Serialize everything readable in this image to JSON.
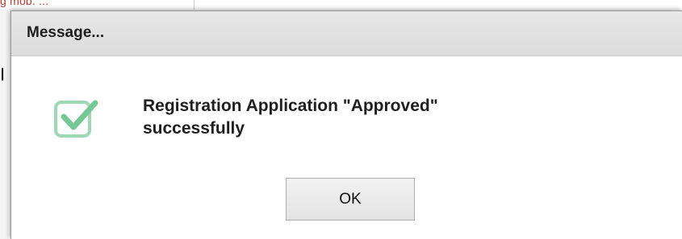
{
  "background": {
    "partial_text": "g mob. ...",
    "partial_char": "I"
  },
  "dialog": {
    "title": "Message...",
    "icon": "check-box-icon",
    "accent_color": "#75c795",
    "message_line1": "Registration Application \"Approved\"",
    "message_line2": "successfully",
    "ok_label": "OK"
  }
}
